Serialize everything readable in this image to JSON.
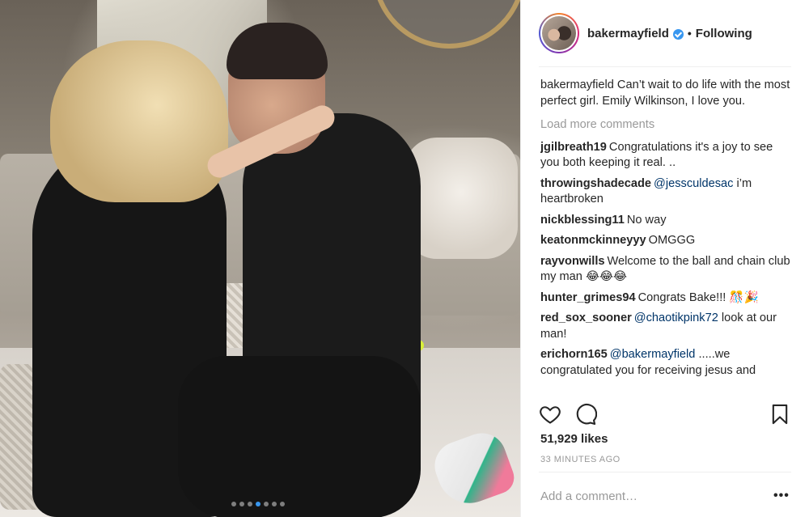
{
  "post": {
    "author": "bakermayfield",
    "follow_state": "Following",
    "separator": "•",
    "caption": "Can’t wait to do life with the most perfect girl. Emily Wilkinson, I love you.",
    "load_more": "Load more comments",
    "comments": [
      {
        "user": "jgilbreath19",
        "mention": "",
        "text": "Congratulations it's a joy to see you both keeping it real. .."
      },
      {
        "user": "throwingshadecade",
        "mention": "@jessculdesac",
        "text": "i’m heartbroken"
      },
      {
        "user": "nickblessing11",
        "mention": "",
        "text": "No way"
      },
      {
        "user": "keatonmckinneyyy",
        "mention": "",
        "text": "OMGGG"
      },
      {
        "user": "rayvonwills",
        "mention": "",
        "text": "Welcome to the ball and chain club my man 😂😂😂"
      },
      {
        "user": "hunter_grimes94",
        "mention": "",
        "text": "Congrats Bake!!! 🎊🎉"
      },
      {
        "user": "red_sox_sooner",
        "mention": "@chaotikpink72",
        "text": "look at our man!"
      },
      {
        "user": "erichorn165",
        "mention": "@bakermayfield",
        "text": ".....we congratulated you for receiving jesus and"
      }
    ],
    "likes": "51,929 likes",
    "time": "33 MINUTES AGO",
    "add_comment_placeholder": "Add a comment…",
    "more_symbol": "•••",
    "carousel": {
      "count": 7,
      "active_index": 3
    }
  },
  "icons": {
    "like": "heart-icon",
    "comment": "speech-bubble-icon",
    "save": "bookmark-icon",
    "verified": "verified-badge-icon"
  },
  "colors": {
    "accent": "#3897f0",
    "mention": "#003569",
    "muted": "#999999",
    "text": "#262626"
  }
}
